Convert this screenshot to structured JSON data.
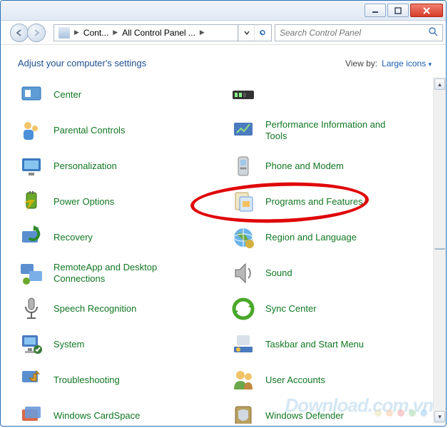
{
  "window": {
    "minimize": "—",
    "maximize": "□",
    "close": "×"
  },
  "breadcrumb": {
    "seg1": "Cont...",
    "seg2": "All Control Panel ..."
  },
  "search": {
    "placeholder": "Search Control Panel"
  },
  "header": {
    "title": "Adjust your computer's settings",
    "viewby_label": "View by:",
    "viewby_value": "Large icons"
  },
  "items_left": [
    {
      "label": "Center",
      "icon": "center-icon"
    },
    {
      "label": "Parental Controls",
      "icon": "parental-icon"
    },
    {
      "label": "Personalization",
      "icon": "personalization-icon"
    },
    {
      "label": "Power Options",
      "icon": "power-icon"
    },
    {
      "label": "Recovery",
      "icon": "recovery-icon"
    },
    {
      "label": "RemoteApp and Desktop Connections",
      "icon": "remoteapp-icon"
    },
    {
      "label": "Speech Recognition",
      "icon": "speech-icon"
    },
    {
      "label": "System",
      "icon": "system-icon"
    },
    {
      "label": "Troubleshooting",
      "icon": "troubleshoot-icon"
    },
    {
      "label": "Windows CardSpace",
      "icon": "cardspace-icon"
    }
  ],
  "items_right": [
    {
      "label": "",
      "icon": "meter-icon"
    },
    {
      "label": "Performance Information and Tools",
      "icon": "performance-icon"
    },
    {
      "label": "Phone and Modem",
      "icon": "phone-icon"
    },
    {
      "label": "Programs and Features",
      "icon": "programs-icon",
      "highlight": true
    },
    {
      "label": "Region and Language",
      "icon": "region-icon"
    },
    {
      "label": "Sound",
      "icon": "sound-icon"
    },
    {
      "label": "Sync Center",
      "icon": "sync-icon"
    },
    {
      "label": "Taskbar and Start Menu",
      "icon": "taskbar-icon"
    },
    {
      "label": "User Accounts",
      "icon": "users-icon"
    },
    {
      "label": "Windows Defender",
      "icon": "defender-icon"
    }
  ],
  "watermark": "Download.com.vn",
  "dot_colors": [
    "#e8e4b4",
    "#f4c8a6",
    "#f2a6a6",
    "#a6d8a6",
    "#9ed0f2"
  ]
}
